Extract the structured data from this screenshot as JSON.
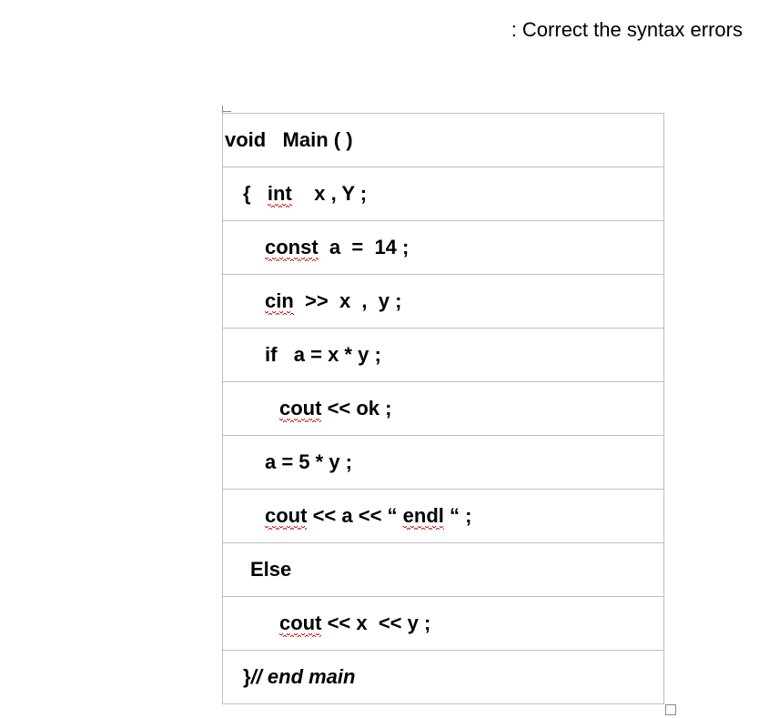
{
  "title": ": Correct the syntax errors",
  "code": {
    "lines": [
      {
        "indent": 2,
        "segments": [
          {
            "t": "void   Main ( )",
            "sq": false
          }
        ]
      },
      {
        "indent": 22,
        "segments": [
          {
            "t": "{   ",
            "sq": false
          },
          {
            "t": "int",
            "sq": true
          },
          {
            "t": "    x , Y ;",
            "sq": false
          }
        ]
      },
      {
        "indent": 46,
        "segments": [
          {
            "t": "const",
            "sq": true
          },
          {
            "t": "  a  =  14 ;",
            "sq": false
          }
        ]
      },
      {
        "indent": 46,
        "segments": [
          {
            "t": "cin",
            "sq": true
          },
          {
            "t": "  >>  x  ,  y ;",
            "sq": false
          }
        ]
      },
      {
        "indent": 46,
        "segments": [
          {
            "t": "if   a = x * y ;",
            "sq": false
          }
        ]
      },
      {
        "indent": 62,
        "segments": [
          {
            "t": "cout",
            "sq": true
          },
          {
            "t": " << ok ;",
            "sq": false
          }
        ]
      },
      {
        "indent": 46,
        "segments": [
          {
            "t": "a = 5 * y ;",
            "sq": false
          }
        ]
      },
      {
        "indent": 46,
        "segments": [
          {
            "t": "cout",
            "sq": true
          },
          {
            "t": " << a << “ ",
            "sq": false
          },
          {
            "t": "endl",
            "sq": true
          },
          {
            "t": " “ ;",
            "sq": false
          }
        ]
      },
      {
        "indent": 30,
        "segments": [
          {
            "t": "Else",
            "sq": false
          }
        ]
      },
      {
        "indent": 62,
        "segments": [
          {
            "t": "cout",
            "sq": true
          },
          {
            "t": " << x  << y ;",
            "sq": false
          }
        ]
      },
      {
        "indent": 22,
        "segments": [
          {
            "t": "}",
            "sq": false
          },
          {
            "t": "// end main",
            "sq": false,
            "italic": true
          }
        ]
      }
    ]
  }
}
